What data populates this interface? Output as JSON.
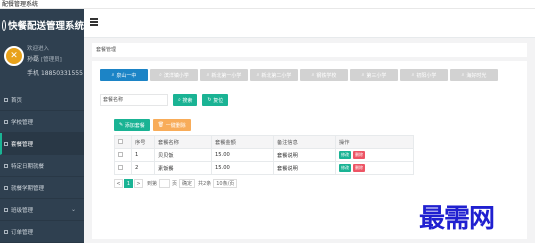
{
  "window": {
    "title": "配餐管理系统"
  },
  "sidebar": {
    "brand": "快餐配送管理系统",
    "welcome": "欢迎进入",
    "user_name": "孙磊",
    "user_role": "[管理员]",
    "phone_label": "手机",
    "phone": "18850331555",
    "items": [
      {
        "label": "首页",
        "icon": "home-icon"
      },
      {
        "label": "学校管理",
        "icon": "school-icon"
      },
      {
        "label": "套餐管理",
        "icon": "menu-icon"
      },
      {
        "label": "特定日期就餐",
        "icon": "calendar-icon"
      },
      {
        "label": "就餐学期管理",
        "icon": "term-icon"
      },
      {
        "label": "班级管理",
        "icon": "class-icon",
        "has_children": true
      },
      {
        "label": "订单管理",
        "icon": "order-icon"
      }
    ]
  },
  "breadcrumb": "套餐管理",
  "school_tabs": [
    "泉山一中",
    "滨洋镇小学",
    "新北第一小学",
    "新北第二小学",
    "钢铁学校",
    "第三小学",
    "初阳小学",
    "海好时光"
  ],
  "search": {
    "placeholder": "套餐名称",
    "search_label": "搜索",
    "reset_label": "复位"
  },
  "actions": {
    "add_label": "添加套餐",
    "batch_delete_label": "一键删除"
  },
  "table": {
    "headers": [
      "",
      "序号",
      "套餐名称",
      "套餐金额",
      "备注信息",
      "操作"
    ],
    "rows": [
      {
        "index": "1",
        "name": "贝贝饭",
        "price": "15.00",
        "note": "套餐说明"
      },
      {
        "index": "2",
        "name": "素饭餐",
        "price": "15.00",
        "note": "套餐说明"
      }
    ],
    "edit_label": "修改",
    "delete_label": "删除"
  },
  "pagination": {
    "prev": "<",
    "current": "1",
    "next": ">",
    "goto_label": "到第",
    "page_unit": "页",
    "confirm": "确定",
    "total": "共2条",
    "page_size": "10条/页"
  },
  "watermark": "最需网",
  "colors": {
    "sidebar": "#2f4050",
    "accent": "#1ab394",
    "primary": "#1c84c6",
    "danger": "#ed5565",
    "warning": "#f8ac59"
  }
}
